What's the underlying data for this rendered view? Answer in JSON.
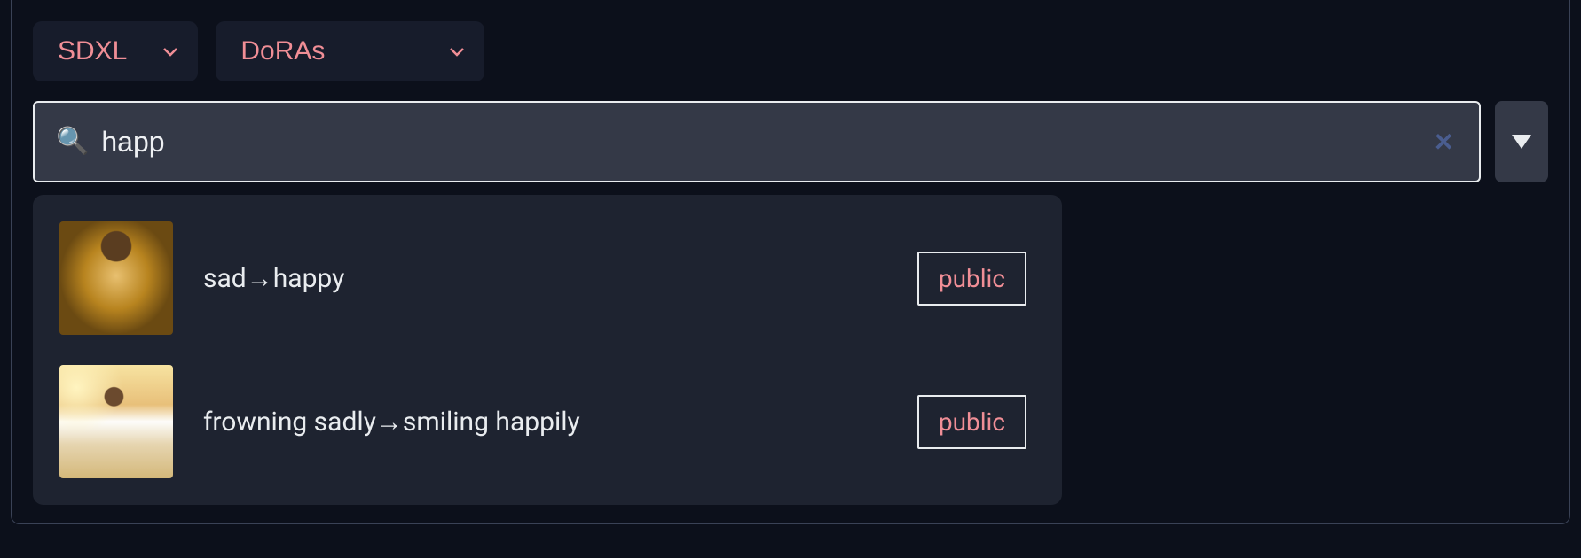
{
  "filters": {
    "model": "SDXL",
    "category": "DoRAs"
  },
  "search": {
    "value": "happ",
    "icon": "🔍"
  },
  "results": [
    {
      "label": "sad→happy",
      "badge": "public",
      "thumb": "gold"
    },
    {
      "label": "frowning sadly→smiling happily",
      "badge": "public",
      "thumb": "beach"
    }
  ]
}
